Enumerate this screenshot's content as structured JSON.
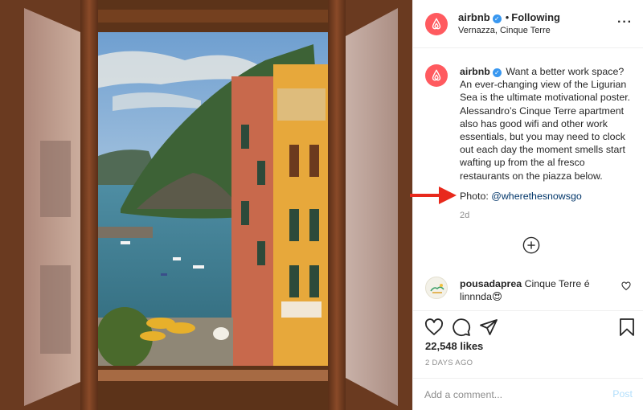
{
  "post": {
    "author": "airbnb",
    "follow_status": "Following",
    "location": "Vernazza, Cinque Terre",
    "caption": "Want a better work space? An ever-changing view of the Ligurian Sea is the ultimate motivational poster. Alessandro’s Cinque Terre apartment also has good wifi and other work essentials, but you may need to clock out each day the moment smells start wafting up from the al fresco restaurants on the piazza below.",
    "credit_label": "Photo:",
    "credit_handle": "@wherethesnowsgo",
    "caption_age": "2d",
    "likes": "22,548 likes",
    "posted": "2 DAYS AGO"
  },
  "comment": {
    "user": "pousadaprea",
    "text": "Cinque Terre é linnnda😍"
  },
  "add_comment": {
    "placeholder": "Add a comment...",
    "post_label": "Post"
  },
  "icons": {
    "avatar": "airbnb-logo-icon",
    "verified": "verified-badge-icon",
    "more": "more-options-icon",
    "load_more": "plus-circle-icon",
    "like": "heart-icon",
    "comment": "comment-bubble-icon",
    "share": "paper-plane-icon",
    "save": "bookmark-icon",
    "annotation": "red-arrow-icon"
  },
  "colors": {
    "brand": "#ff5a5f",
    "verified": "#3897f0",
    "link": "#003569",
    "post_disabled": "#b2dffc",
    "annotation": "#e8291c"
  }
}
